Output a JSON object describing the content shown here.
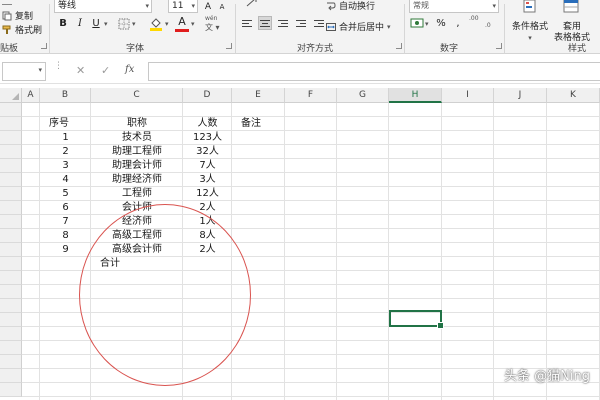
{
  "ribbon": {
    "clipboard": {
      "copy": "复制",
      "format_painter": "格式刷",
      "group": "贴板"
    },
    "font": {
      "name": "等线",
      "size": "11",
      "group": "字体",
      "bold": "B",
      "italic": "I",
      "underline": "U",
      "color_letter": "A",
      "grow": "A",
      "shrink": "A",
      "phonetic": "wén"
    },
    "alignment": {
      "wrap_text": "自动换行",
      "merge_center": "合并后居中",
      "group": "对齐方式"
    },
    "number": {
      "format": "常规",
      "percent": "%",
      "comma": ",",
      "group": "数字",
      "inc_decimal": ".00",
      "dec_decimal": ".0"
    },
    "styles": {
      "conditional": "条件格式",
      "table_1": "套用",
      "table_2": "表格格式",
      "group": "样式"
    }
  },
  "formula_bar": {
    "cancel": "✕",
    "enter": "✓",
    "fx": "fx"
  },
  "columns": [
    "A",
    "B",
    "C",
    "D",
    "E",
    "F",
    "G",
    "H",
    "I",
    "J",
    "K"
  ],
  "selected_column": "H",
  "sheet": {
    "headers": {
      "seq": "序号",
      "title": "职称",
      "count": "人数",
      "note": "备注"
    },
    "rows": [
      {
        "seq": "1",
        "title": "技术员",
        "count": "123人"
      },
      {
        "seq": "2",
        "title": "助理工程师",
        "count": "32人"
      },
      {
        "seq": "3",
        "title": "助理会计师",
        "count": "7人"
      },
      {
        "seq": "4",
        "title": "助理经济师",
        "count": "3人"
      },
      {
        "seq": "5",
        "title": "工程师",
        "count": "12人"
      },
      {
        "seq": "6",
        "title": "会计师",
        "count": "2人"
      },
      {
        "seq": "7",
        "title": "经济师",
        "count": "1人"
      },
      {
        "seq": "8",
        "title": "高级工程师",
        "count": "8人"
      },
      {
        "seq": "9",
        "title": "高级会计师",
        "count": "2人"
      }
    ],
    "total_label": "合计"
  },
  "watermark": "头条 @猫Ning",
  "colors": {
    "accent": "#217346",
    "annotation": "#d9534f"
  }
}
